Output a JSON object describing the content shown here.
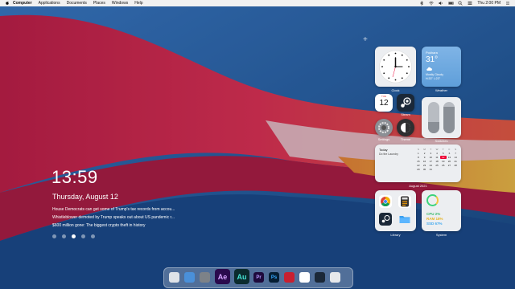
{
  "menubar": {
    "items": [
      "Computer",
      "Applications",
      "Documents",
      "Places",
      "Windows",
      "Help"
    ],
    "clock": "Thu 2:00 PM"
  },
  "lockscreen": {
    "time": "13:59",
    "date": "Thursday, August 12",
    "news": [
      "House Democrats can get some of Trump's tax records from accou...",
      "Whistleblower demoted by Trump speaks out about US pandemic r...",
      "$600 million gone: The biggest crypto theft in history"
    ],
    "page_dots": 5,
    "active_dot": 3
  },
  "widgets": {
    "clock_label": "Clock",
    "clock_time": "2:00",
    "weather": {
      "label": "Weather",
      "city": "Pokhara",
      "temp": "31°",
      "condition": "Mostly Cloudy",
      "range": "H:33° L:23°"
    },
    "calendar_icon": {
      "month": "TUE",
      "day": "12"
    },
    "steam_label": "Steam",
    "settings_label": "Settings",
    "mode_label": "Theme",
    "switch_label": "Switches",
    "switch_levels": [
      0.35,
      0.85
    ],
    "calendar": {
      "label": "August 2021",
      "header": "Today",
      "event": "Do the Laundry",
      "weekdays": [
        "S",
        "M",
        "T",
        "W",
        "T",
        "F",
        "S"
      ],
      "days": [
        "1",
        "2",
        "3",
        "4",
        "5",
        "6",
        "7",
        "8",
        "9",
        "10",
        "11",
        "12",
        "13",
        "14",
        "15",
        "16",
        "17",
        "18",
        "19",
        "20",
        "21",
        "22",
        "23",
        "24",
        "25",
        "26",
        "27",
        "28",
        "29",
        "30",
        "31"
      ],
      "today": "12"
    },
    "library_label": "Library",
    "system": {
      "label": "System",
      "cpu": "CPU 2%",
      "ram": "RAM 18%",
      "ssd": "SSD 67%"
    }
  },
  "dock": {
    "apps": [
      {
        "name": "clock-app",
        "text": "",
        "color": "#dfe3e8"
      },
      {
        "name": "app-store",
        "text": "",
        "color": "#4a90d9"
      },
      {
        "name": "settings-app",
        "text": "",
        "color": "#7d8288"
      },
      {
        "name": "after-effects",
        "text": "Ae",
        "color": "#2a0a4d",
        "fg": "#d6a3ff"
      },
      {
        "name": "audition",
        "text": "Au",
        "color": "#0b2b2e",
        "fg": "#44e5d5"
      },
      {
        "name": "premiere",
        "text": "Pr",
        "color": "#1e0a3c",
        "fg": "#b79bff"
      },
      {
        "name": "photoshop",
        "text": "Ps",
        "color": "#061e33",
        "fg": "#35a7ff"
      },
      {
        "name": "mail-app",
        "text": "",
        "color": "#c82030"
      },
      {
        "name": "chrome-app",
        "text": "",
        "color": "#ffffff"
      },
      {
        "name": "steam-app",
        "text": "",
        "color": "#1b2838"
      },
      {
        "name": "trash",
        "text": "",
        "color": "#e6e8eb"
      }
    ]
  },
  "colors": {
    "accent_red": "#e0315a",
    "wallpaper_blue": "#1f5fa8"
  }
}
